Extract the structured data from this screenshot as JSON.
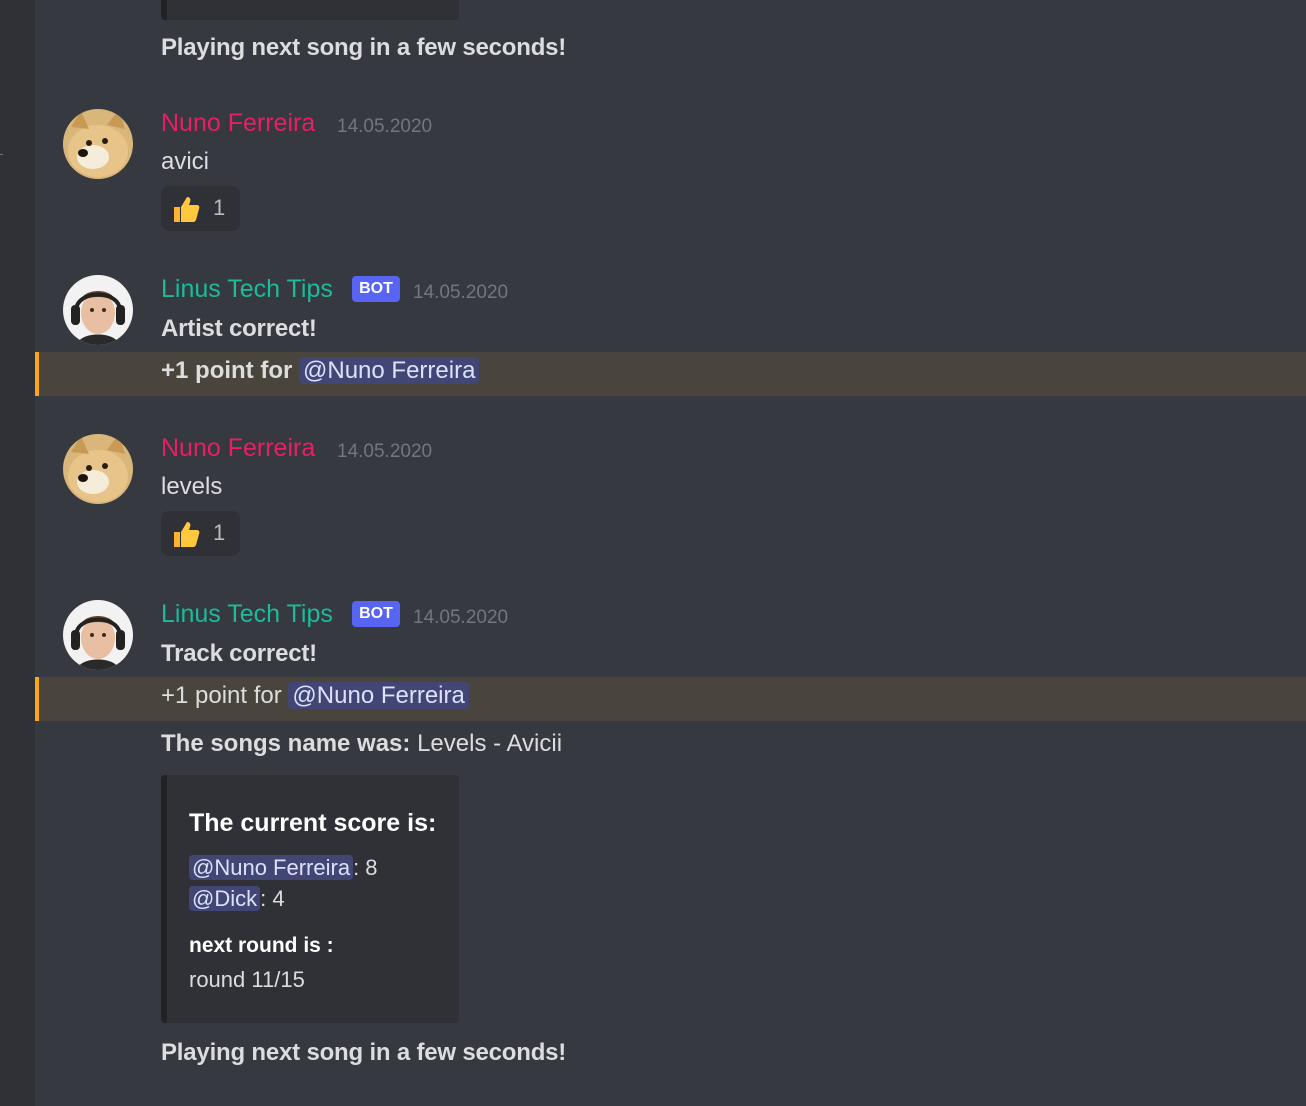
{
  "messages": {
    "playing_next_top": "Playing next song in a few seconds!",
    "m1": {
      "author": "Nuno Ferreira",
      "timestamp": "14.05.2020",
      "text": "avici",
      "reaction_count": "1"
    },
    "m2": {
      "author": "Linus Tech Tips",
      "bot_tag": "BOT",
      "timestamp": "14.05.2020",
      "line1": "Artist correct!",
      "line2_prefix": "+1 point for",
      "mention": "@Nuno Ferreira"
    },
    "m3": {
      "author": "Nuno Ferreira",
      "timestamp": "14.05.2020",
      "text": "levels",
      "reaction_count": "1"
    },
    "m4": {
      "author": "Linus Tech Tips",
      "bot_tag": "BOT",
      "timestamp": "14.05.2020",
      "line1": "Track correct!",
      "line2_prefix": "+1 point for",
      "mention": "@Nuno Ferreira",
      "song_label": "The songs name was:",
      "song_value": "Levels - Avicii",
      "embed": {
        "title": "The current score is:",
        "scores": [
          {
            "mention": "@Nuno Ferreira",
            "score": ": 8"
          },
          {
            "mention": "@Dick",
            "score": ": 4"
          }
        ],
        "field_name": "next round is :",
        "field_value": "round 11/15"
      },
      "playing_next": "Playing next song in a few seconds!"
    }
  },
  "icons": {
    "reaction": "thumbs-up-icon",
    "avatar_nuno": "doge-avatar",
    "avatar_linus": "linus-avatar"
  },
  "colors": {
    "background": "#36393f",
    "nuno": "#e91e63",
    "linus": "#1abc9c",
    "bot_tag": "#5865f2",
    "highlight_border": "#faa61a",
    "mention_bg": "#414675"
  }
}
